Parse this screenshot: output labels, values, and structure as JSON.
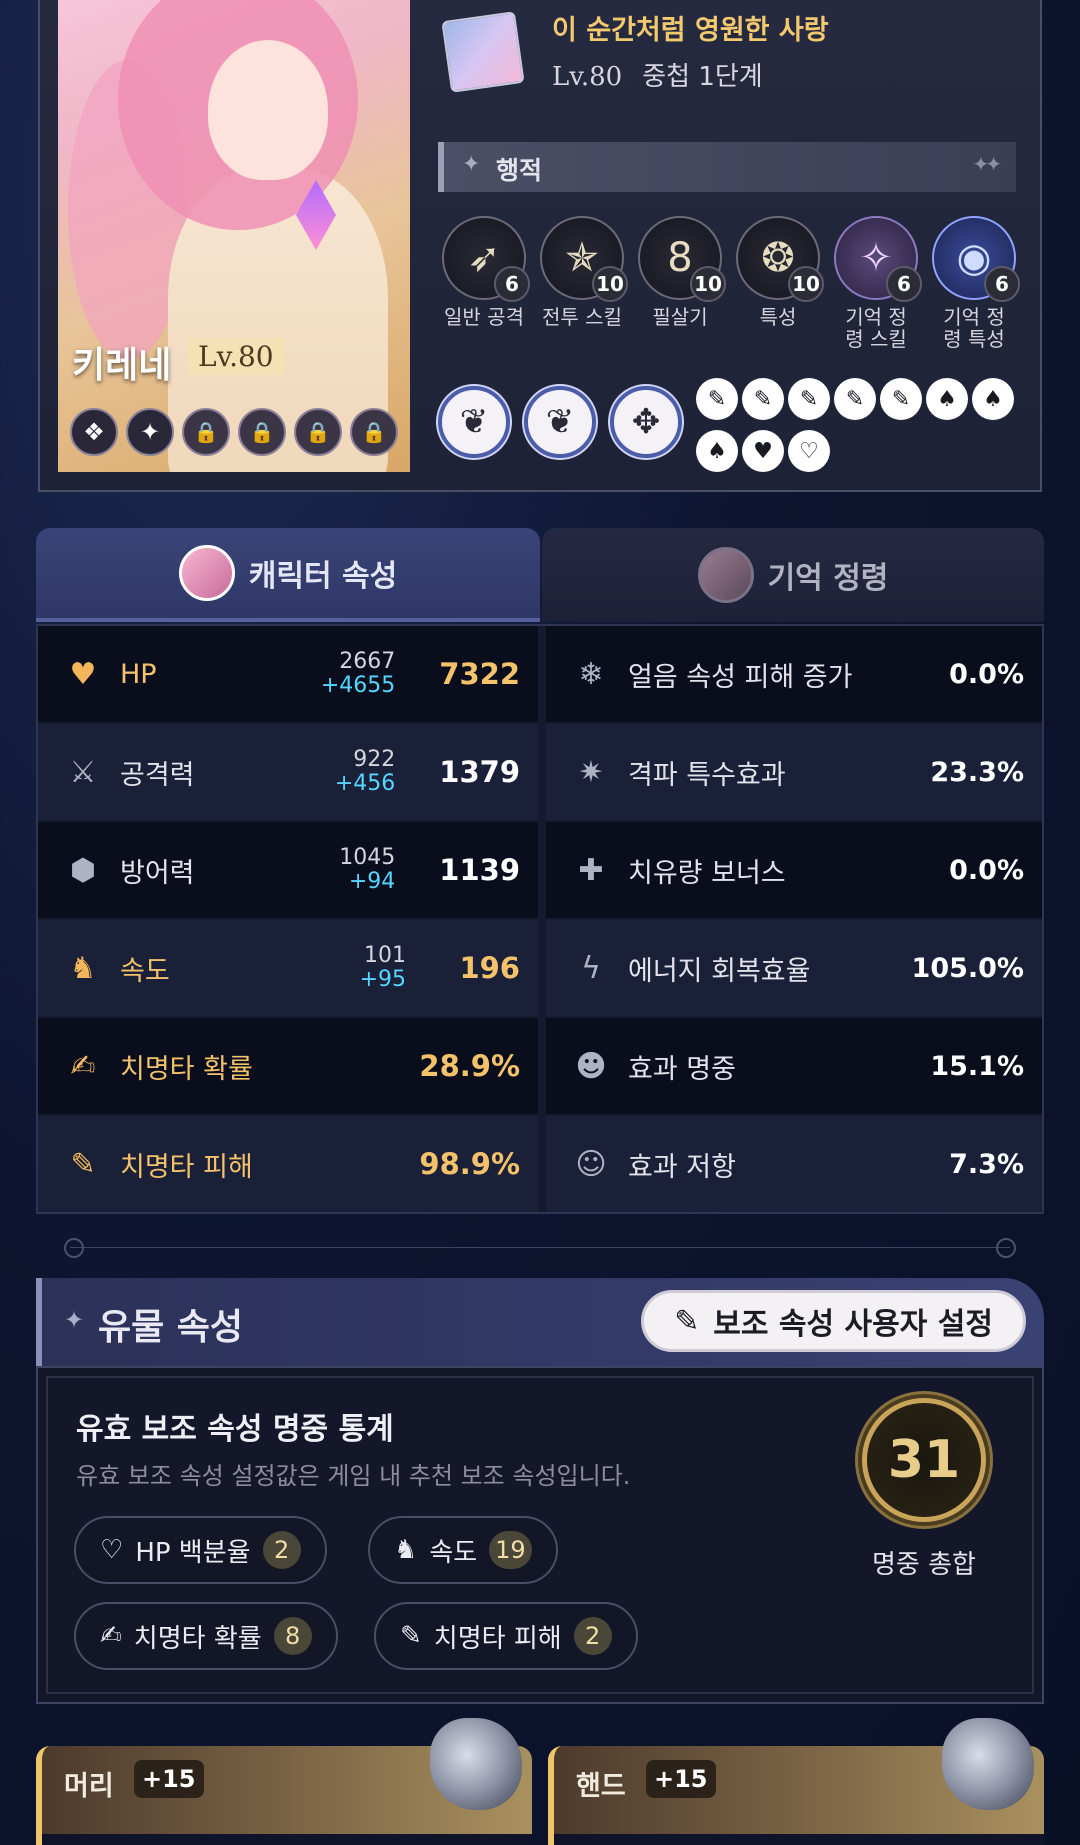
{
  "character": {
    "name": "키레네",
    "level": "Lv.80",
    "eidolons": [
      {
        "icon": "eidolon-1-icon",
        "glyph": "❖",
        "locked": false
      },
      {
        "icon": "eidolon-2-icon",
        "glyph": "✦",
        "locked": false
      },
      {
        "icon": "lock-icon",
        "glyph": "🔒",
        "locked": true
      },
      {
        "icon": "lock-icon",
        "glyph": "🔒",
        "locked": true
      },
      {
        "icon": "lock-icon",
        "glyph": "🔒",
        "locked": true
      },
      {
        "icon": "lock-icon",
        "glyph": "🔒",
        "locked": true
      }
    ]
  },
  "light_cone": {
    "title": "이 순간처럼 영원한 사랑",
    "level": "Lv.80",
    "superimposition": "중첩 1단계"
  },
  "traces": {
    "header": "행적",
    "skills": [
      {
        "name": "일반 공격",
        "level": "6",
        "icon": "basic-attack-icon",
        "glyph": "➶",
        "style": ""
      },
      {
        "name": "전투 스킬",
        "level": "10",
        "icon": "skill-icon",
        "glyph": "✯",
        "style": ""
      },
      {
        "name": "필살기",
        "level": "10",
        "icon": "ultimate-icon",
        "glyph": "8",
        "style": ""
      },
      {
        "name": "특성",
        "level": "10",
        "icon": "talent-icon",
        "glyph": "❂",
        "style": ""
      },
      {
        "name": "기억 정\n령 스킬",
        "level": "6",
        "icon": "memosprite-skill-icon",
        "glyph": "✧",
        "style": "memo"
      },
      {
        "name": "기억 정\n령 특성",
        "level": "6",
        "icon": "memosprite-talent-icon",
        "glyph": "◉",
        "style": "memo2"
      }
    ],
    "minor_traces": [
      {
        "icon": "ability-trace-1-icon",
        "glyph": "❦"
      },
      {
        "icon": "ability-trace-2-icon",
        "glyph": "❦"
      },
      {
        "icon": "ability-trace-3-icon",
        "glyph": "✥"
      }
    ],
    "stat_nodes": [
      {
        "icon": "crit-dmg-node-icon",
        "glyph": "✎"
      },
      {
        "icon": "crit-dmg-node-icon",
        "glyph": "✎"
      },
      {
        "icon": "crit-dmg-node-icon",
        "glyph": "✎"
      },
      {
        "icon": "crit-dmg-node-icon",
        "glyph": "✎"
      },
      {
        "icon": "crit-dmg-node-icon",
        "glyph": "✎"
      },
      {
        "icon": "speed-node-icon",
        "glyph": "♠"
      },
      {
        "icon": "speed-node-icon",
        "glyph": "♠"
      },
      {
        "icon": "speed-node-icon",
        "glyph": "♠"
      },
      {
        "icon": "hp-node-icon",
        "glyph": "♥"
      },
      {
        "icon": "hp-node-icon",
        "glyph": "♡"
      }
    ]
  },
  "tabs": {
    "character_stats": "캐릭터 속성",
    "memosprite": "기억 정령"
  },
  "stats_left": [
    {
      "label": "HP",
      "base": "2667",
      "bonus": "+4655",
      "total": "7322",
      "gold": true,
      "icon": "heart-icon",
      "glyph": "♥"
    },
    {
      "label": "공격력",
      "base": "922",
      "bonus": "+456",
      "total": "1379",
      "gold": false,
      "icon": "sword-icon",
      "glyph": "⚔"
    },
    {
      "label": "방어력",
      "base": "1045",
      "bonus": "+94",
      "total": "1139",
      "gold": false,
      "icon": "shield-icon",
      "glyph": "⬢"
    },
    {
      "label": "속도",
      "base": "101",
      "bonus": "+95",
      "total": "196",
      "gold": true,
      "icon": "boot-icon",
      "glyph": "♞"
    },
    {
      "label": "치명타 확률",
      "base": "",
      "bonus": "",
      "total": "28.9%",
      "gold": true,
      "icon": "crit-rate-icon",
      "glyph": "✍"
    },
    {
      "label": "치명타 피해",
      "base": "",
      "bonus": "",
      "total": "98.9%",
      "gold": true,
      "icon": "crit-dmg-icon",
      "glyph": "✎"
    }
  ],
  "stats_right": [
    {
      "label": "얼음 속성 피해 증가",
      "value": "0.0%",
      "icon": "ice-icon",
      "glyph": "❄"
    },
    {
      "label": "격파 특수효과",
      "value": "23.3%",
      "icon": "break-effect-icon",
      "glyph": "✷"
    },
    {
      "label": "치유량 보너스",
      "value": "0.0%",
      "icon": "healing-icon",
      "glyph": "✚"
    },
    {
      "label": "에너지 회복효율",
      "value": "105.0%",
      "icon": "energy-icon",
      "glyph": "ϟ"
    },
    {
      "label": "효과 명중",
      "value": "15.1%",
      "icon": "effect-hit-icon",
      "glyph": "☻"
    },
    {
      "label": "효과 저항",
      "value": "7.3%",
      "icon": "effect-res-icon",
      "glyph": "☺"
    }
  ],
  "relics": {
    "header": "유물 속성",
    "custom_button": "보조 속성 사용자 설정",
    "stats_title": "유효 보조 속성 명중 통계",
    "stats_desc": "유효 보조 속성 설정값은 게임 내 추천 보조 속성입니다.",
    "pills": [
      {
        "label": "HP 백분율",
        "count": "2",
        "icon": "heart-outline-icon",
        "glyph": "♡"
      },
      {
        "label": "속도",
        "count": "19",
        "icon": "boot-icon",
        "glyph": "♞"
      },
      {
        "label": "치명타 확률",
        "count": "8",
        "icon": "crit-rate-icon",
        "glyph": "✍"
      },
      {
        "label": "치명타 피해",
        "count": "2",
        "icon": "crit-dmg-icon",
        "glyph": "✎"
      }
    ],
    "total_hits": "31",
    "total_label": "명중 총합",
    "pieces": [
      {
        "slot": "머리",
        "level": "+15"
      },
      {
        "slot": "핸드",
        "level": "+15"
      }
    ]
  }
}
